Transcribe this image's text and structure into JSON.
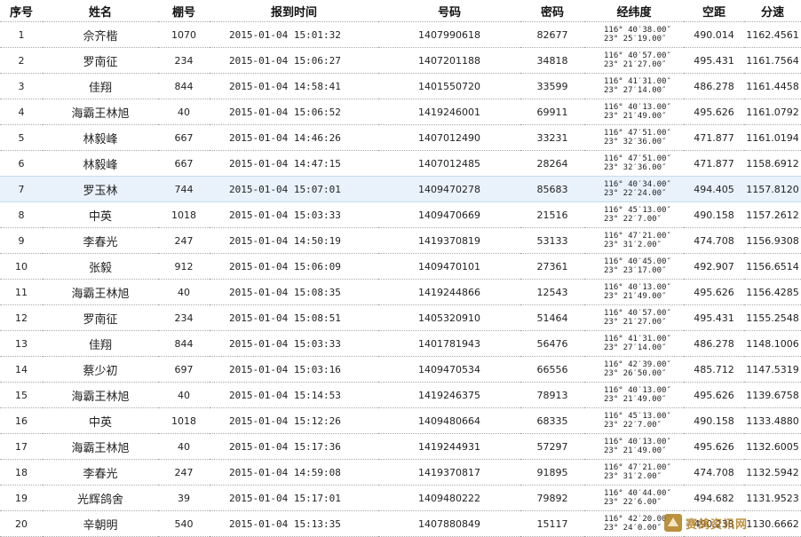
{
  "headers": {
    "rank": "序号",
    "name": "姓名",
    "loft": "棚号",
    "arrival_time": "报到时间",
    "ring": "号码",
    "code": "密码",
    "coord": "经纬度",
    "distance": "空距",
    "speed": "分速"
  },
  "rows": [
    {
      "rank": "1",
      "name": "佘齐楷",
      "loft": "1070",
      "time": "2015-01-04 15:01:32",
      "ring": "1407990618",
      "code": "82677",
      "lon": "116° 40′38.00″",
      "lat": "23° 25′19.00″",
      "distance": "490.014",
      "speed": "1162.4561"
    },
    {
      "rank": "2",
      "name": "罗南征",
      "loft": "234",
      "time": "2015-01-04 15:06:27",
      "ring": "1407201188",
      "code": "34818",
      "lon": "116° 40′57.00″",
      "lat": "23° 21′27.00″",
      "distance": "495.431",
      "speed": "1161.7564"
    },
    {
      "rank": "3",
      "name": "佳翔",
      "loft": "844",
      "time": "2015-01-04 14:58:41",
      "ring": "1401550720",
      "code": "33599",
      "lon": "116° 41′31.00″",
      "lat": "23° 27′14.00″",
      "distance": "486.278",
      "speed": "1161.4458"
    },
    {
      "rank": "4",
      "name": "海霸王林旭",
      "loft": "40",
      "time": "2015-01-04 15:06:52",
      "ring": "1419246001",
      "code": "69911",
      "lon": "116° 40′13.00″",
      "lat": "23° 21′49.00″",
      "distance": "495.626",
      "speed": "1161.0792"
    },
    {
      "rank": "5",
      "name": "林毅峰",
      "loft": "667",
      "time": "2015-01-04 14:46:26",
      "ring": "1407012490",
      "code": "33231",
      "lon": "116° 47′51.00″",
      "lat": "23° 32′36.00″",
      "distance": "471.877",
      "speed": "1161.0194"
    },
    {
      "rank": "6",
      "name": "林毅峰",
      "loft": "667",
      "time": "2015-01-04 14:47:15",
      "ring": "1407012485",
      "code": "28264",
      "lon": "116° 47′51.00″",
      "lat": "23° 32′36.00″",
      "distance": "471.877",
      "speed": "1158.6912"
    },
    {
      "rank": "7",
      "name": "罗玉林",
      "loft": "744",
      "time": "2015-01-04 15:07:01",
      "ring": "1409470278",
      "code": "85683",
      "lon": "116° 40′34.00″",
      "lat": "23° 22′24.00″",
      "distance": "494.405",
      "speed": "1157.8120"
    },
    {
      "rank": "8",
      "name": "中英",
      "loft": "1018",
      "time": "2015-01-04 15:03:33",
      "ring": "1409470669",
      "code": "21516",
      "lon": "116° 45′13.00″",
      "lat": "23° 22′7.00″",
      "distance": "490.158",
      "speed": "1157.2612"
    },
    {
      "rank": "9",
      "name": "李春光",
      "loft": "247",
      "time": "2015-01-04 14:50:19",
      "ring": "1419370819",
      "code": "53133",
      "lon": "116° 47′21.00″",
      "lat": "23° 31′2.00″",
      "distance": "474.708",
      "speed": "1156.9308"
    },
    {
      "rank": "10",
      "name": "张毅",
      "loft": "912",
      "time": "2015-01-04 15:06:09",
      "ring": "1409470101",
      "code": "27361",
      "lon": "116° 40′45.00″",
      "lat": "23° 23′17.00″",
      "distance": "492.907",
      "speed": "1156.6514"
    },
    {
      "rank": "11",
      "name": "海霸王林旭",
      "loft": "40",
      "time": "2015-01-04 15:08:35",
      "ring": "1419244866",
      "code": "12543",
      "lon": "116° 40′13.00″",
      "lat": "23° 21′49.00″",
      "distance": "495.626",
      "speed": "1156.4285"
    },
    {
      "rank": "12",
      "name": "罗南征",
      "loft": "234",
      "time": "2015-01-04 15:08:51",
      "ring": "1405320910",
      "code": "51464",
      "lon": "116° 40′57.00″",
      "lat": "23° 21′27.00″",
      "distance": "495.431",
      "speed": "1155.2548"
    },
    {
      "rank": "13",
      "name": "佳翔",
      "loft": "844",
      "time": "2015-01-04 15:03:33",
      "ring": "1401781943",
      "code": "56476",
      "lon": "116° 41′31.00″",
      "lat": "23° 27′14.00″",
      "distance": "486.278",
      "speed": "1148.1006"
    },
    {
      "rank": "14",
      "name": "蔡少初",
      "loft": "697",
      "time": "2015-01-04 15:03:16",
      "ring": "1409470534",
      "code": "66556",
      "lon": "116° 42′39.00″",
      "lat": "23° 26′50.00″",
      "distance": "485.712",
      "speed": "1147.5319"
    },
    {
      "rank": "15",
      "name": "海霸王林旭",
      "loft": "40",
      "time": "2015-01-04 15:14:53",
      "ring": "1419246375",
      "code": "78913",
      "lon": "116° 40′13.00″",
      "lat": "23° 21′49.00″",
      "distance": "495.626",
      "speed": "1139.6758"
    },
    {
      "rank": "16",
      "name": "中英",
      "loft": "1018",
      "time": "2015-01-04 15:12:26",
      "ring": "1409480664",
      "code": "68335",
      "lon": "116° 45′13.00″",
      "lat": "23° 22′7.00″",
      "distance": "490.158",
      "speed": "1133.4880"
    },
    {
      "rank": "17",
      "name": "海霸王林旭",
      "loft": "40",
      "time": "2015-01-04 15:17:36",
      "ring": "1419244931",
      "code": "57297",
      "lon": "116° 40′13.00″",
      "lat": "23° 21′49.00″",
      "distance": "495.626",
      "speed": "1132.6005"
    },
    {
      "rank": "18",
      "name": "李春光",
      "loft": "247",
      "time": "2015-01-04 14:59:08",
      "ring": "1419370817",
      "code": "91895",
      "lon": "116° 47′21.00″",
      "lat": "23° 31′2.00″",
      "distance": "474.708",
      "speed": "1132.5942"
    },
    {
      "rank": "19",
      "name": "光辉鸽舍",
      "loft": "39",
      "time": "2015-01-04 15:17:01",
      "ring": "1409480222",
      "code": "79892",
      "lon": "116° 40′44.00″",
      "lat": "23° 22′6.00″",
      "distance": "494.682",
      "speed": "1131.9523"
    },
    {
      "rank": "20",
      "name": "辛朝明",
      "loft": "540",
      "time": "2015-01-04 15:13:35",
      "ring": "1407880849",
      "code": "15117",
      "lon": "116° 42′20.00″",
      "lat": "23° 24′0.00″",
      "distance": "490.238",
      "speed": "1130.6662"
    }
  ],
  "highlight_row": 7,
  "watermark": {
    "text": "赛鸽资讯网",
    "icon": "pigeon-logo-icon"
  },
  "colors": {
    "highlight_bg": "#e9f2fb",
    "border": "#aaaaaa",
    "watermark": "#b07d1e"
  }
}
